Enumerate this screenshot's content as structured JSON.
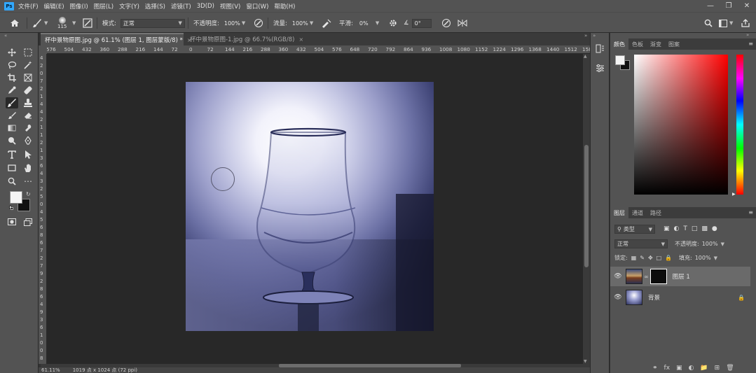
{
  "menubar": {
    "app_logo": "Ps",
    "items": [
      "文件(F)",
      "编辑(E)",
      "图像(I)",
      "图层(L)",
      "文字(Y)",
      "选择(S)",
      "滤镜(T)",
      "3D(D)",
      "视图(V)",
      "窗口(W)",
      "帮助(H)"
    ],
    "window_controls": [
      "minimize-icon",
      "restore-icon",
      "close-icon"
    ]
  },
  "options": {
    "brush_size": "115",
    "mode_label": "模式:",
    "mode_value": "正常",
    "opacity_label": "不透明度:",
    "opacity_value": "100%",
    "flow_label": "流量:",
    "flow_value": "100%",
    "smooth_label": "平滑:",
    "smooth_value": "0%",
    "angle_value": "0°"
  },
  "tabs": [
    {
      "label": "杯中景物原图.jpg @ 61.1% (图层 1, 图层蒙版/8) *",
      "active": true
    },
    {
      "label": "杯中景物原图-1.jpg @ 66.7%(RGB/8)",
      "active": false
    }
  ],
  "ruler": {
    "top_ticks": [
      "576",
      "504",
      "432",
      "360",
      "288",
      "216",
      "144",
      "72",
      "0",
      "72",
      "144",
      "216",
      "288",
      "360",
      "432",
      "504",
      "576",
      "648",
      "720",
      "792",
      "864",
      "936",
      "1008",
      "1080",
      "1152",
      "1224",
      "1296",
      "1368",
      "1440",
      "1512",
      "158"
    ],
    "left_ticks": [
      "4",
      "2",
      "0",
      "7",
      "2",
      "1",
      "4",
      "4",
      "2",
      "1",
      "1",
      "2",
      "1",
      "3",
      "6",
      "4",
      "3",
      "2",
      "5",
      "0",
      "4",
      "5",
      "6",
      "8",
      "6",
      "7",
      "2",
      "7",
      "9",
      "2",
      "8",
      "6",
      "4",
      "9",
      "3",
      "6",
      "1",
      "0",
      "0",
      "8"
    ]
  },
  "status": {
    "zoom": "61.11%",
    "doc_info": "1019 点 x 1024 点 (72 ppi)"
  },
  "color_panel": {
    "tabs": [
      "颜色",
      "色板",
      "渐变",
      "图案"
    ],
    "foreground": "#f5f5f5",
    "background": "#111111",
    "hue": "#ff0000"
  },
  "layers_panel": {
    "tabs": [
      "图层",
      "通道",
      "路径"
    ],
    "filter_label": "类型",
    "blend_mode": "正常",
    "opacity_label": "不透明度:",
    "opacity_value": "100%",
    "lock_label": "锁定:",
    "fill_label": "填充:",
    "fill_value": "100%",
    "layers": [
      {
        "name": "图层 1",
        "selected": true,
        "has_mask": true
      },
      {
        "name": "背景",
        "selected": false,
        "locked": true
      }
    ]
  }
}
